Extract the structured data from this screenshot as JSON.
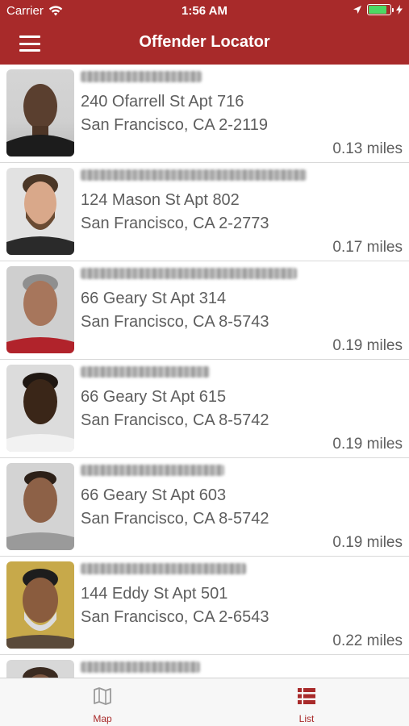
{
  "status_bar": {
    "carrier": "Carrier",
    "time": "1:56 AM",
    "battery_level": 0.85
  },
  "nav": {
    "title": "Offender Locator"
  },
  "offenders": [
    {
      "address1": "240 Ofarrell St Apt 716",
      "address2": "San Francisco, CA 2-2119",
      "distance": "0.13 miles"
    },
    {
      "address1": "124 Mason St Apt 802",
      "address2": "San Francisco, CA 2-2773",
      "distance": "0.17 miles"
    },
    {
      "address1": "66 Geary St Apt 314",
      "address2": "San Francisco, CA 8-5743",
      "distance": "0.19 miles"
    },
    {
      "address1": "66 Geary St Apt 615",
      "address2": "San Francisco, CA 8-5742",
      "distance": "0.19 miles"
    },
    {
      "address1": "66 Geary St Apt 603",
      "address2": "San Francisco, CA 8-5742",
      "distance": "0.19 miles"
    },
    {
      "address1": "144 Eddy St Apt 501",
      "address2": "San Francisco, CA 2-6543",
      "distance": "0.22 miles"
    },
    {
      "address1": "",
      "address2": "",
      "distance": ""
    }
  ],
  "tabs": {
    "map": "Map",
    "list": "List"
  },
  "colors": {
    "brand": "#a82a2a"
  }
}
